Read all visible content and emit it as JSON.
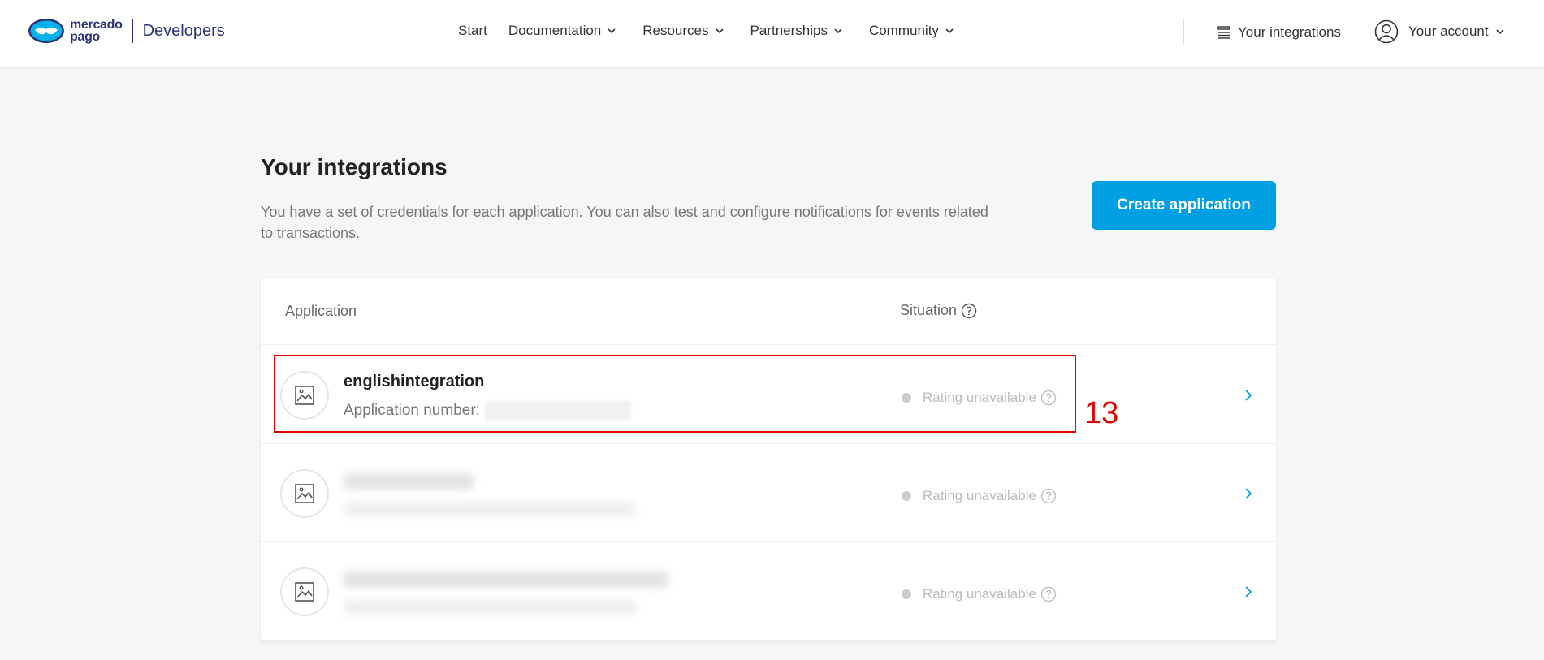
{
  "header": {
    "logo_top": "mercado",
    "logo_bottom": "pago",
    "logo_suffix": "Developers",
    "nav": [
      {
        "label": "Start"
      },
      {
        "label": "Documentation"
      },
      {
        "label": "Resources"
      },
      {
        "label": "Partnerships"
      },
      {
        "label": "Community"
      }
    ],
    "integrations_link": "Your integrations",
    "account_link": "Your account"
  },
  "main": {
    "title": "Your integrations",
    "description": "You have a set of credentials for each application. You can also test and configure notifications for events related to transactions.",
    "create_button": "Create application"
  },
  "table": {
    "col_application": "Application",
    "col_situation": "Situation",
    "rows": [
      {
        "name": "englishintegration",
        "number_label": "Application number:",
        "status": "Rating unavailable"
      },
      {
        "status": "Rating unavailable"
      },
      {
        "status": "Rating unavailable"
      }
    ]
  },
  "annotation": {
    "label": "13",
    "color": "#e00000"
  },
  "colors": {
    "accent": "#009ee3",
    "brand": "#2d3277"
  }
}
